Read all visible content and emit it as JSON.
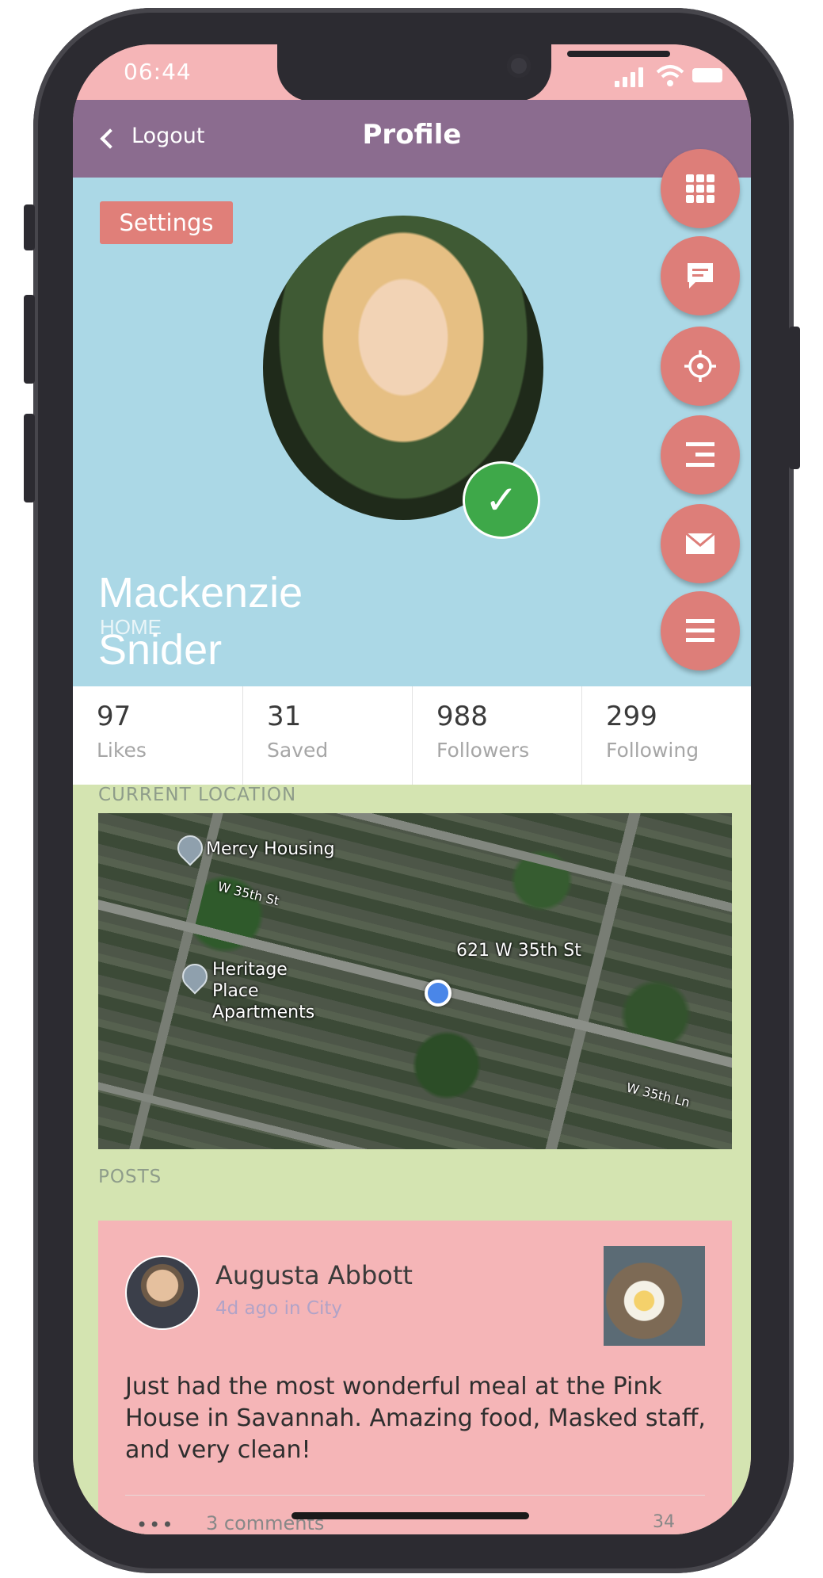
{
  "status_bar": {
    "time": "06:44"
  },
  "nav": {
    "back_label": "Logout",
    "title": "Profile"
  },
  "profile": {
    "settings_label": "Settings",
    "name": "Mackenzie Snider",
    "location_tag": "HOME",
    "verified": true
  },
  "fab_buttons": [
    {
      "name": "apps-grid",
      "icon": "grid-icon"
    },
    {
      "name": "message",
      "icon": "chat-bubble-icon"
    },
    {
      "name": "locate",
      "icon": "crosshair-icon"
    },
    {
      "name": "sort",
      "icon": "align-right-icon"
    },
    {
      "name": "mail",
      "icon": "envelope-icon"
    },
    {
      "name": "menu",
      "icon": "hamburger-icon"
    }
  ],
  "stats": [
    {
      "value": "97",
      "label": "Likes"
    },
    {
      "value": "31",
      "label": "Saved"
    },
    {
      "value": "988",
      "label": "Followers"
    },
    {
      "value": "299",
      "label": "Following"
    }
  ],
  "location": {
    "heading": "CURRENT LOCATION",
    "places": [
      "Mercy Housing",
      "Heritage Place Apartments"
    ],
    "current_address": "621 W 35th St",
    "streets": [
      "W 35th St",
      "W 35th Ln"
    ]
  },
  "posts": {
    "heading": "POSTS",
    "items": [
      {
        "author": "Augusta Abbott",
        "meta": "4d ago in City",
        "text": "Just had the most wonderful meal at the Pink House in Savannah. Amazing food, Masked staff, and very clean!",
        "comments": "3 comments",
        "age": "34"
      }
    ]
  },
  "colors": {
    "status_bar": "#f5b5b7",
    "nav_bar": "#8b6c8f",
    "header_bg": "#abd8e6",
    "accent": "#dd7e79",
    "content_bg": "#d4e4b1",
    "post_card": "#f5b5b7",
    "verified": "#3ea849"
  }
}
